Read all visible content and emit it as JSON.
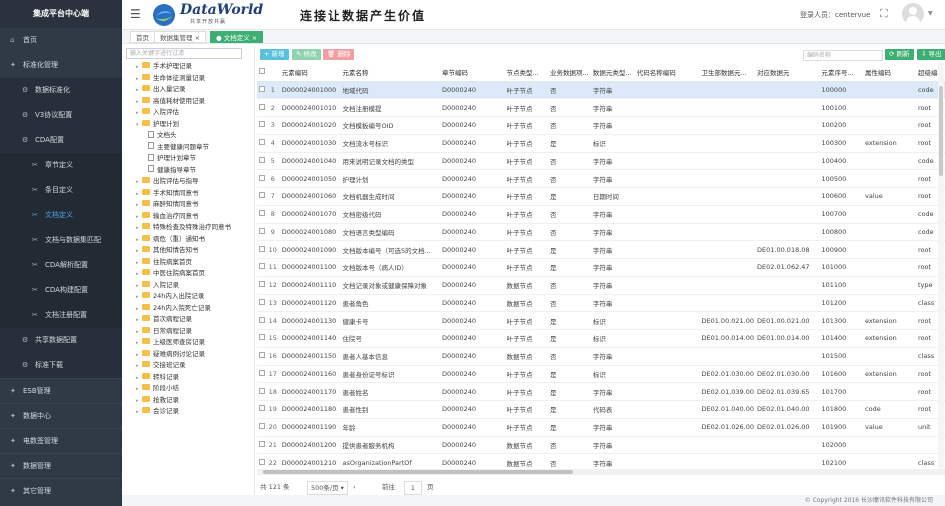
{
  "app": {
    "title": "集成平台中心端"
  },
  "sidebar": {
    "items": [
      {
        "label": "首页",
        "icon": "home-icon",
        "glyph": "⌂",
        "level": 1
      },
      {
        "label": "标准化管理",
        "icon": "standard-icon",
        "glyph": "✦",
        "level": 1
      },
      {
        "label": "数据标准化",
        "icon": "gear-icon",
        "glyph": "⚙",
        "level": 2
      },
      {
        "label": "V3协议配置",
        "icon": "gear-icon",
        "glyph": "⚙",
        "level": 2
      },
      {
        "label": "CDA配置",
        "icon": "gear-icon",
        "glyph": "⚙",
        "level": 2
      },
      {
        "label": "章节定义",
        "icon": "tools-icon",
        "glyph": "✂",
        "level": 3
      },
      {
        "label": "条目定义",
        "icon": "tools-icon",
        "glyph": "✂",
        "level": 3
      },
      {
        "label": "文档定义",
        "icon": "tools-icon",
        "glyph": "✂",
        "level": 3,
        "active": true
      },
      {
        "label": "文档与数据集匹配",
        "icon": "tools-icon",
        "glyph": "✂",
        "level": 3
      },
      {
        "label": "CDA解析配置",
        "icon": "tools-icon",
        "glyph": "✂",
        "level": 3
      },
      {
        "label": "CDA构建配置",
        "icon": "tools-icon",
        "glyph": "✂",
        "level": 3
      },
      {
        "label": "文档注册配置",
        "icon": "tools-icon",
        "glyph": "✂",
        "level": 3
      },
      {
        "label": "共享数据配置",
        "icon": "gear-icon",
        "glyph": "⚙",
        "level": 2
      },
      {
        "label": "标准下载",
        "icon": "gear-icon",
        "glyph": "⚙",
        "level": 2
      },
      {
        "label": "ESB管理",
        "icon": "esb-icon",
        "glyph": "✦",
        "level": 1,
        "section": true
      },
      {
        "label": "数据中心",
        "icon": "data-center-icon",
        "glyph": "✦",
        "level": 1,
        "section": true
      },
      {
        "label": "电数签管理",
        "icon": "signature-icon",
        "glyph": "✦",
        "level": 1,
        "section": true
      },
      {
        "label": "数据管理",
        "icon": "data-manage-icon",
        "glyph": "✦",
        "level": 1,
        "section": true
      },
      {
        "label": "其它管理",
        "icon": "other-icon",
        "glyph": "✦",
        "level": 1,
        "section": true
      }
    ]
  },
  "header": {
    "logo_text": "DataWorld",
    "logo_sub": "共享开放共赢",
    "slogan": "连接让数据产生价值",
    "user_label": "登录人员：",
    "user_name": "centervue"
  },
  "tabs": [
    {
      "label": "首页"
    },
    {
      "label": "数据集管理 ×"
    },
    {
      "label": "● 文档定义 ×",
      "active": true
    }
  ],
  "tree": {
    "search_placeholder": "输入关键字进行过滤",
    "nodes": [
      {
        "label": "手术护理记录",
        "type": "folder",
        "level": 1
      },
      {
        "label": "生命体征测量记录",
        "type": "folder",
        "level": 1
      },
      {
        "label": "出入量记录",
        "type": "folder",
        "level": 1
      },
      {
        "label": "高值耗材使用记录",
        "type": "folder",
        "level": 1
      },
      {
        "label": "入院评估",
        "type": "folder",
        "level": 1
      },
      {
        "label": "护理计划",
        "type": "folder",
        "level": 1,
        "open": true
      },
      {
        "label": "文档头",
        "type": "doc",
        "level": 2
      },
      {
        "label": "主要健康问题章节",
        "type": "doc",
        "level": 2
      },
      {
        "label": "护理计划章节",
        "type": "doc",
        "level": 2
      },
      {
        "label": "健康指导章节",
        "type": "doc",
        "level": 2
      },
      {
        "label": "出院评估与指导",
        "type": "folder",
        "level": 1
      },
      {
        "label": "手术知情同意书",
        "type": "folder",
        "level": 1
      },
      {
        "label": "麻醉知情同意书",
        "type": "folder",
        "level": 1
      },
      {
        "label": "输血治疗同意书",
        "type": "folder",
        "level": 1
      },
      {
        "label": "特殊检查及特殊治疗同意书",
        "type": "folder",
        "level": 1
      },
      {
        "label": "病危（重）通知书",
        "type": "folder",
        "level": 1
      },
      {
        "label": "其他知情告知书",
        "type": "folder",
        "level": 1
      },
      {
        "label": "住院病案首页",
        "type": "folder",
        "level": 1
      },
      {
        "label": "中医住院病案首页",
        "type": "folder",
        "level": 1
      },
      {
        "label": "入院记录",
        "type": "folder",
        "level": 1
      },
      {
        "label": "24h内入出院记录",
        "type": "folder",
        "level": 1
      },
      {
        "label": "24h内入院死亡记录",
        "type": "folder",
        "level": 1
      },
      {
        "label": "首次病程记录",
        "type": "folder",
        "level": 1
      },
      {
        "label": "日常病程记录",
        "type": "folder",
        "level": 1
      },
      {
        "label": "上级医师查房记录",
        "type": "folder",
        "level": 1
      },
      {
        "label": "疑难病例讨论记录",
        "type": "folder",
        "level": 1
      },
      {
        "label": "交接班记录",
        "type": "folder",
        "level": 1
      },
      {
        "label": "转科记录",
        "type": "folder",
        "level": 1
      },
      {
        "label": "阶段小结",
        "type": "folder",
        "level": 1
      },
      {
        "label": "抢救记录",
        "type": "folder",
        "level": 1
      },
      {
        "label": "会诊记录",
        "type": "folder",
        "level": 1
      }
    ]
  },
  "toolbar": {
    "add_label": "+ 新增",
    "edit_label": "✎ 修改",
    "delete_label": "🗑 删除",
    "search_placeholder": "编码名称",
    "refresh_label": "⟳ 刷新",
    "export_label": "⇩ 导出"
  },
  "table": {
    "columns": [
      "",
      "",
      "元素编码",
      "元素名称",
      "章节编码",
      "节点类型...",
      "业务数据项...",
      "数据元类型...",
      "代码名称编码",
      "卫生部数据元...",
      "对应数据元",
      "元素序号...",
      "属性编码",
      "超级编码"
    ],
    "rows": [
      {
        "n": "1",
        "code": "D000024001000",
        "name": "地域代码",
        "chapter": "D0000240",
        "ntype": "叶子节点",
        "biz": "否",
        "dtype": "字符串",
        "codename": "",
        "wsb": "",
        "ref": "",
        "seq": "100000",
        "attr": "",
        "super": "code"
      },
      {
        "n": "2",
        "code": "D000024001010",
        "name": "文档注册模提",
        "chapter": "D0000240",
        "ntype": "叶子节点",
        "biz": "否",
        "dtype": "字符串",
        "codename": "",
        "wsb": "",
        "ref": "",
        "seq": "100100",
        "attr": "",
        "super": "root"
      },
      {
        "n": "3",
        "code": "D000024001020",
        "name": "文档模板编号OID",
        "chapter": "D0000240",
        "ntype": "叶子节点",
        "biz": "否",
        "dtype": "字符串",
        "codename": "",
        "wsb": "",
        "ref": "",
        "seq": "100200",
        "attr": "",
        "super": "root"
      },
      {
        "n": "4",
        "code": "D000024001030",
        "name": "文档流水号标识",
        "chapter": "D0000240",
        "ntype": "叶子节点",
        "biz": "是",
        "dtype": "标识",
        "codename": "",
        "wsb": "",
        "ref": "",
        "seq": "100300",
        "attr": "extension",
        "super": "root"
      },
      {
        "n": "5",
        "code": "D000024001040",
        "name": "用来说明记录文档的类型",
        "chapter": "D0000240",
        "ntype": "叶子节点",
        "biz": "否",
        "dtype": "字符串",
        "codename": "",
        "wsb": "",
        "ref": "",
        "seq": "100400",
        "attr": "",
        "super": "code"
      },
      {
        "n": "6",
        "code": "D000024001050",
        "name": "护理计划",
        "chapter": "D0000240",
        "ntype": "叶子节点",
        "biz": "否",
        "dtype": "字符串",
        "codename": "",
        "wsb": "",
        "ref": "",
        "seq": "100500",
        "attr": "",
        "super": "root"
      },
      {
        "n": "7",
        "code": "D000024001060",
        "name": "文档机器生成时间",
        "chapter": "D0000240",
        "ntype": "叶子节点",
        "biz": "是",
        "dtype": "日期时间",
        "codename": "",
        "wsb": "",
        "ref": "",
        "seq": "100600",
        "attr": "value",
        "super": "root"
      },
      {
        "n": "8",
        "code": "D000024001070",
        "name": "文档密级代码",
        "chapter": "D0000240",
        "ntype": "叶子节点",
        "biz": "否",
        "dtype": "字符串",
        "codename": "",
        "wsb": "",
        "ref": "",
        "seq": "100700",
        "attr": "",
        "super": "code"
      },
      {
        "n": "9",
        "code": "D000024001080",
        "name": "文档语言类型编码",
        "chapter": "D0000240",
        "ntype": "叶子节点",
        "biz": "否",
        "dtype": "字符串",
        "codename": "",
        "wsb": "",
        "ref": "",
        "seq": "100800",
        "attr": "",
        "super": "code"
      },
      {
        "n": "10",
        "code": "D000024001090",
        "name": "文档版本编号（可选5的文档...",
        "chapter": "D0000240",
        "ntype": "叶子节点",
        "biz": "是",
        "dtype": "字符串",
        "codename": "",
        "wsb": "",
        "ref": "DE01.00.018.08",
        "seq": "100900",
        "attr": "",
        "super": "root"
      },
      {
        "n": "11",
        "code": "D000024001100",
        "name": "文档版本号（病人ID）",
        "chapter": "D0000240",
        "ntype": "叶子节点",
        "biz": "是",
        "dtype": "字符串",
        "codename": "",
        "wsb": "",
        "ref": "DE02.01.062.47",
        "seq": "101000",
        "attr": "",
        "super": "root"
      },
      {
        "n": "12",
        "code": "D000024001110",
        "name": "文档记录对象或健康保障对象",
        "chapter": "D0000240",
        "ntype": "数据节点",
        "biz": "否",
        "dtype": "字符串",
        "codename": "",
        "wsb": "",
        "ref": "",
        "seq": "101100",
        "attr": "",
        "super": "type"
      },
      {
        "n": "13",
        "code": "D000024001120",
        "name": "患者角色",
        "chapter": "D0000240",
        "ntype": "数据节点",
        "biz": "否",
        "dtype": "字符串",
        "codename": "",
        "wsb": "",
        "ref": "",
        "seq": "101200",
        "attr": "",
        "super": "class"
      },
      {
        "n": "14",
        "code": "D000024001130",
        "name": "健康卡号",
        "chapter": "D0000240",
        "ntype": "叶子节点",
        "biz": "是",
        "dtype": "标识",
        "codename": "",
        "wsb": "DE01.00.021.00",
        "ref": "DE01.00.021.00",
        "seq": "101300",
        "attr": "extension",
        "super": "root"
      },
      {
        "n": "15",
        "code": "D000024001140",
        "name": "住院号",
        "chapter": "D0000240",
        "ntype": "叶子节点",
        "biz": "是",
        "dtype": "标识",
        "codename": "",
        "wsb": "DE01.00.014.00",
        "ref": "DE01.00.014.00",
        "seq": "101400",
        "attr": "extension",
        "super": "root"
      },
      {
        "n": "16",
        "code": "D000024001150",
        "name": "患者人基本信息",
        "chapter": "D0000240",
        "ntype": "数据节点",
        "biz": "否",
        "dtype": "字符串",
        "codename": "",
        "wsb": "",
        "ref": "",
        "seq": "101500",
        "attr": "",
        "super": "class"
      },
      {
        "n": "17",
        "code": "D000024001160",
        "name": "患者身份证号标识",
        "chapter": "D0000240",
        "ntype": "叶子节点",
        "biz": "是",
        "dtype": "标识",
        "codename": "",
        "wsb": "DE02.01.030.00",
        "ref": "DE02.01.030.00",
        "seq": "101600",
        "attr": "extension",
        "super": "root"
      },
      {
        "n": "18",
        "code": "D000024001170",
        "name": "患者姓名",
        "chapter": "D0000240",
        "ntype": "叶子节点",
        "biz": "是",
        "dtype": "字符串",
        "codename": "",
        "wsb": "DE02.01.039.00",
        "ref": "DE02.01.039.65",
        "seq": "101700",
        "attr": "",
        "super": "root"
      },
      {
        "n": "19",
        "code": "D000024001180",
        "name": "患者性别",
        "chapter": "D0000240",
        "ntype": "叶子节点",
        "biz": "是",
        "dtype": "代码表",
        "codename": "",
        "wsb": "DE02.01.040.00",
        "ref": "DE02.01.040.00",
        "seq": "101800",
        "attr": "code",
        "super": "root"
      },
      {
        "n": "20",
        "code": "D000024001190",
        "name": "年龄",
        "chapter": "D0000240",
        "ntype": "叶子节点",
        "biz": "是",
        "dtype": "字符串",
        "codename": "",
        "wsb": "DE02.01.026.00",
        "ref": "DE02.01.026.00",
        "seq": "101900",
        "attr": "value",
        "super": "unit"
      },
      {
        "n": "21",
        "code": "D000024001200",
        "name": "提供患者服务机构",
        "chapter": "D0000240",
        "ntype": "数据节点",
        "biz": "否",
        "dtype": "字符串",
        "codename": "",
        "wsb": "",
        "ref": "",
        "seq": "102000",
        "attr": "",
        "super": ""
      },
      {
        "n": "22",
        "code": "D000024001210",
        "name": "asOrganizationPartOf",
        "chapter": "D0000240",
        "ntype": "数据节点",
        "biz": "否",
        "dtype": "字符串",
        "codename": "",
        "wsb": "",
        "ref": "",
        "seq": "102100",
        "attr": "",
        "super": "class"
      }
    ]
  },
  "pager": {
    "total": "共 121 条",
    "size": "500条/页 ▾",
    "prev": "‹",
    "goto": "前往",
    "page": "1",
    "page_unit": "页",
    "next": "›"
  },
  "footer": {
    "copyright": "© Copyright 2016 长沙摩讯软件科技有限公司"
  }
}
